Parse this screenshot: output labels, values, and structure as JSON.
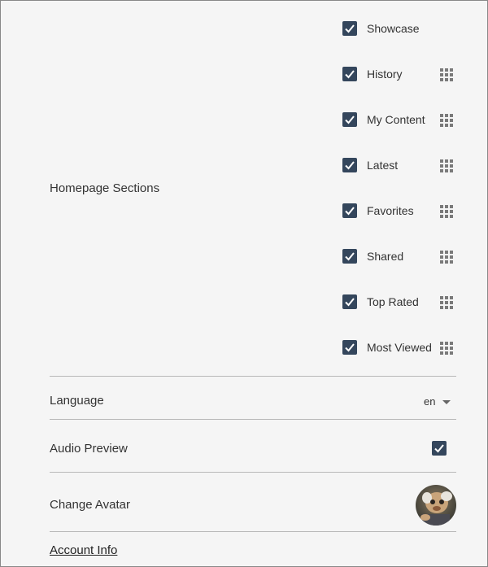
{
  "homepage_sections": {
    "label": "Homepage Sections",
    "items": [
      {
        "label": "Showcase",
        "checked": true,
        "draggable": false
      },
      {
        "label": "History",
        "checked": true,
        "draggable": true
      },
      {
        "label": "My Content",
        "checked": true,
        "draggable": true
      },
      {
        "label": "Latest",
        "checked": true,
        "draggable": true
      },
      {
        "label": "Favorites",
        "checked": true,
        "draggable": true
      },
      {
        "label": "Shared",
        "checked": true,
        "draggable": true
      },
      {
        "label": "Top Rated",
        "checked": true,
        "draggable": true
      },
      {
        "label": "Most Viewed",
        "checked": true,
        "draggable": true
      }
    ]
  },
  "language": {
    "label": "Language",
    "value": "en"
  },
  "audio_preview": {
    "label": "Audio Preview",
    "checked": true
  },
  "change_avatar": {
    "label": "Change Avatar"
  },
  "account_info": {
    "label": "Account Info"
  },
  "colors": {
    "checkbox": "#34465c",
    "divider": "#b8b8b8",
    "background": "#f5f5f5",
    "handle": "#7a7a7a"
  },
  "icons": {
    "checkbox": "checkmark-icon",
    "drag": "drag-grid-icon",
    "dropdown": "caret-down-icon"
  }
}
